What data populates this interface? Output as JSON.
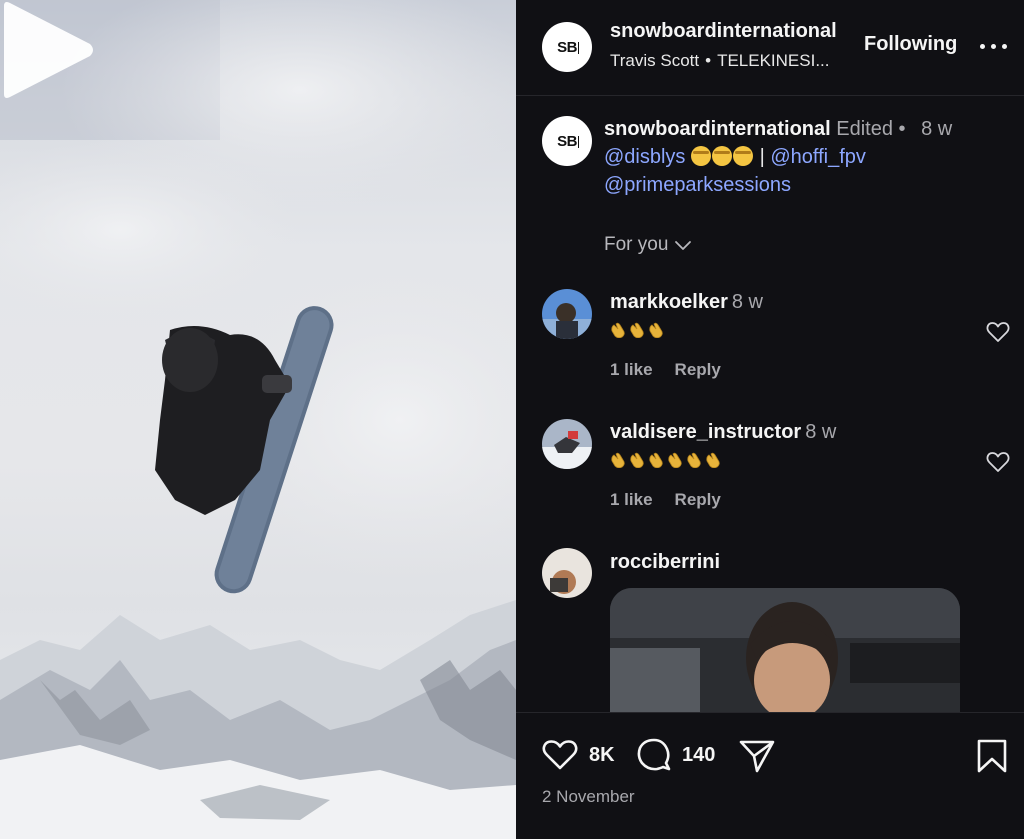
{
  "header": {
    "avatar_text": "SB",
    "username": "snowboardinternational",
    "audio_artist": "Travis Scott",
    "audio_separator": "•",
    "audio_track": "TELEKINESI...",
    "follow_label": "Following"
  },
  "caption": {
    "avatar_text": "SB",
    "username": "snowboardinternational",
    "edited": "Edited",
    "separator": "•",
    "age": "8 w",
    "mention_1": "@disblys",
    "divider": "|",
    "mention_2": "@hoffi_fpv",
    "mention_3": "@primeparksessions",
    "emoji_count": 3
  },
  "sort": {
    "label": "For you"
  },
  "comments": [
    {
      "username": "markkoelker",
      "time": "8 w",
      "claps": 3,
      "likes": "1 like",
      "reply": "Reply"
    },
    {
      "username": "valdisere_instructor",
      "time": "8 w",
      "claps": 6,
      "likes": "1 like",
      "reply": "Reply"
    },
    {
      "username": "rocciberrini"
    }
  ],
  "footer": {
    "likes": "8K",
    "comments": "140",
    "date": "2 November"
  },
  "icons": {
    "play": "play-icon",
    "more": "more-horizontal-icon",
    "chevron": "chevron-down-icon",
    "heart": "heart-icon",
    "comment": "comment-icon",
    "share": "send-icon",
    "save": "bookmark-icon"
  },
  "colors": {
    "panel_bg": "#101014",
    "mention": "#8da7ff",
    "secondary_text": "#a8a8ad"
  }
}
